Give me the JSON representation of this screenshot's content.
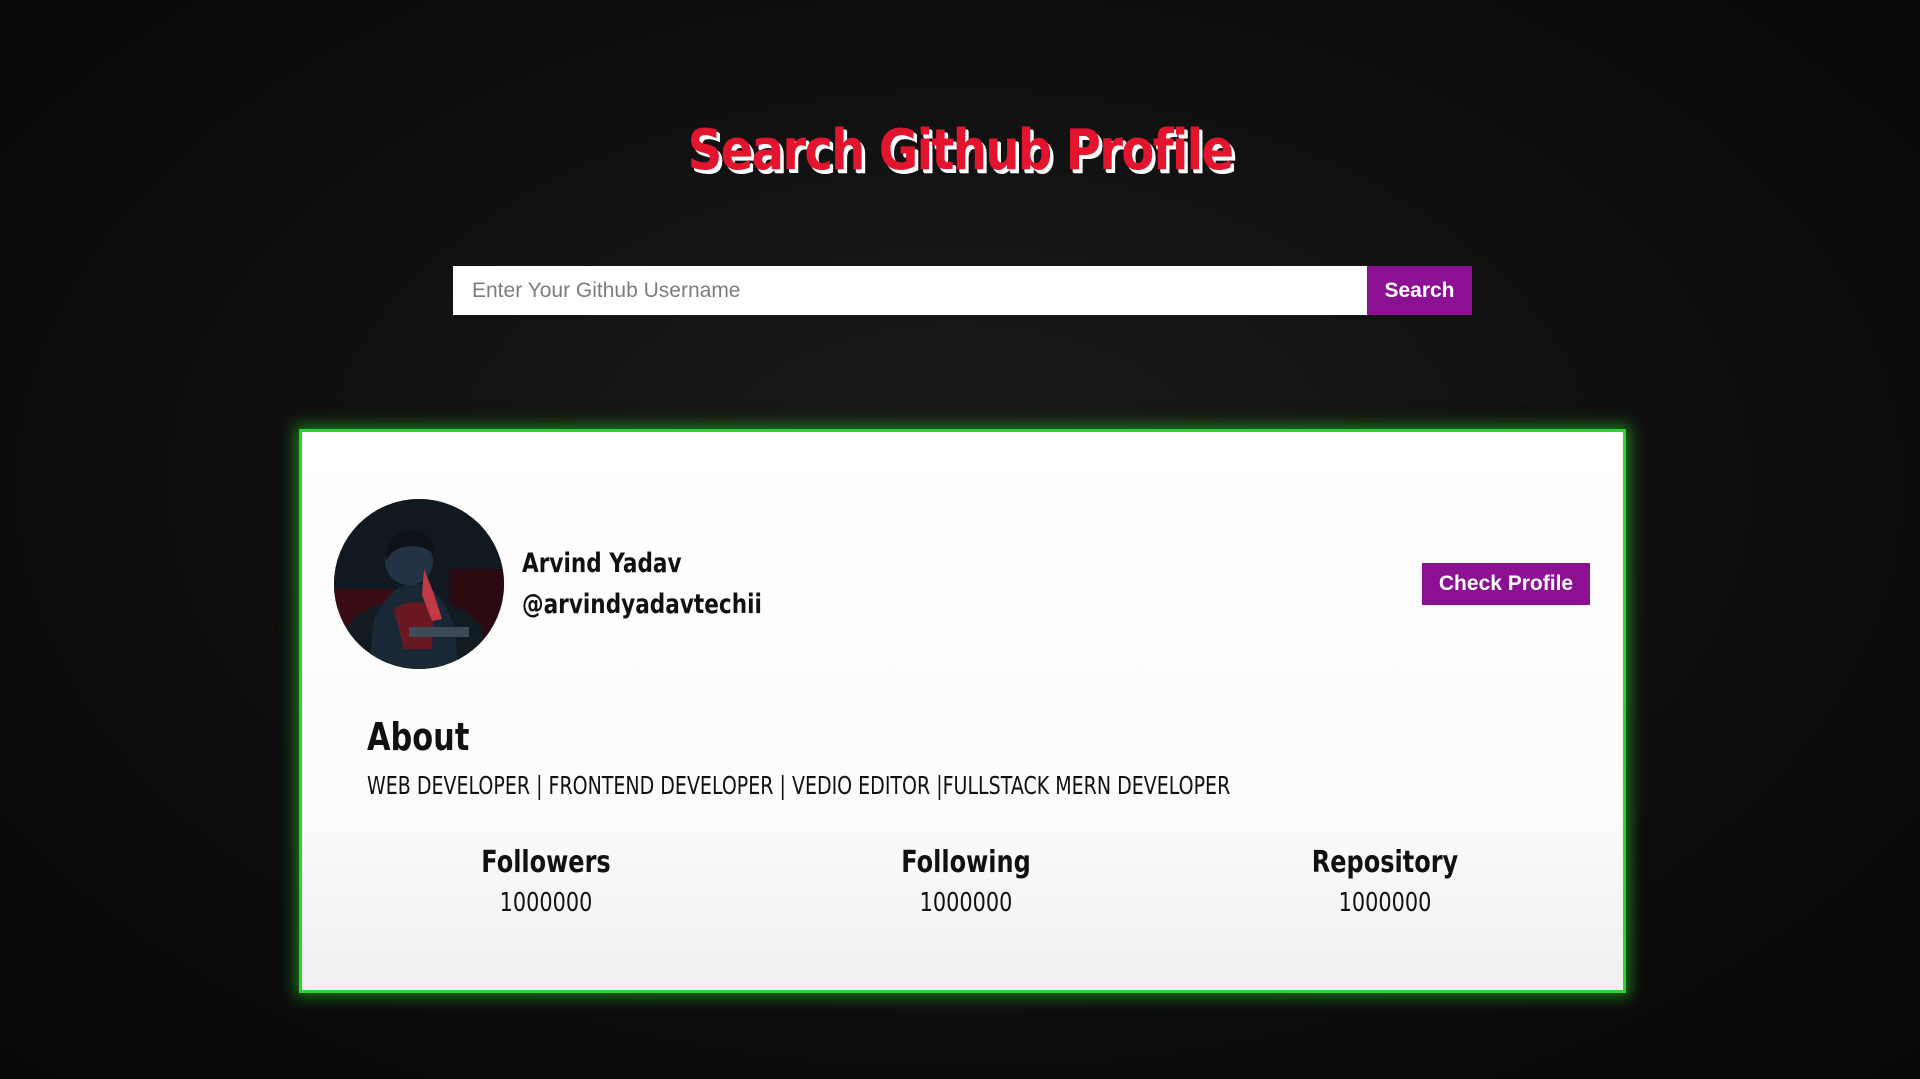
{
  "page": {
    "title": "Search Github Profile"
  },
  "search": {
    "placeholder": "Enter Your Github Username",
    "value": "",
    "button_label": "Search"
  },
  "profile": {
    "name": "Arvind Yadav",
    "username": "@arvindyadavtechii",
    "check_profile_label": "Check Profile",
    "about_heading": "About",
    "bio": "WEB DEVELOPER | FRONTEND DEVELOPER | VEDIO EDITOR |FULLSTACK MERN DEVELOPER",
    "stats": [
      {
        "label": "Followers",
        "value": "1000000"
      },
      {
        "label": "Following",
        "value": "1000000"
      },
      {
        "label": "Repository",
        "value": "1000000"
      }
    ]
  },
  "colors": {
    "background": "#111111",
    "title": "#e3142d",
    "accent_button": "#8b1192",
    "card_glow": "#2bd62b",
    "card_background": "#ffffff"
  }
}
